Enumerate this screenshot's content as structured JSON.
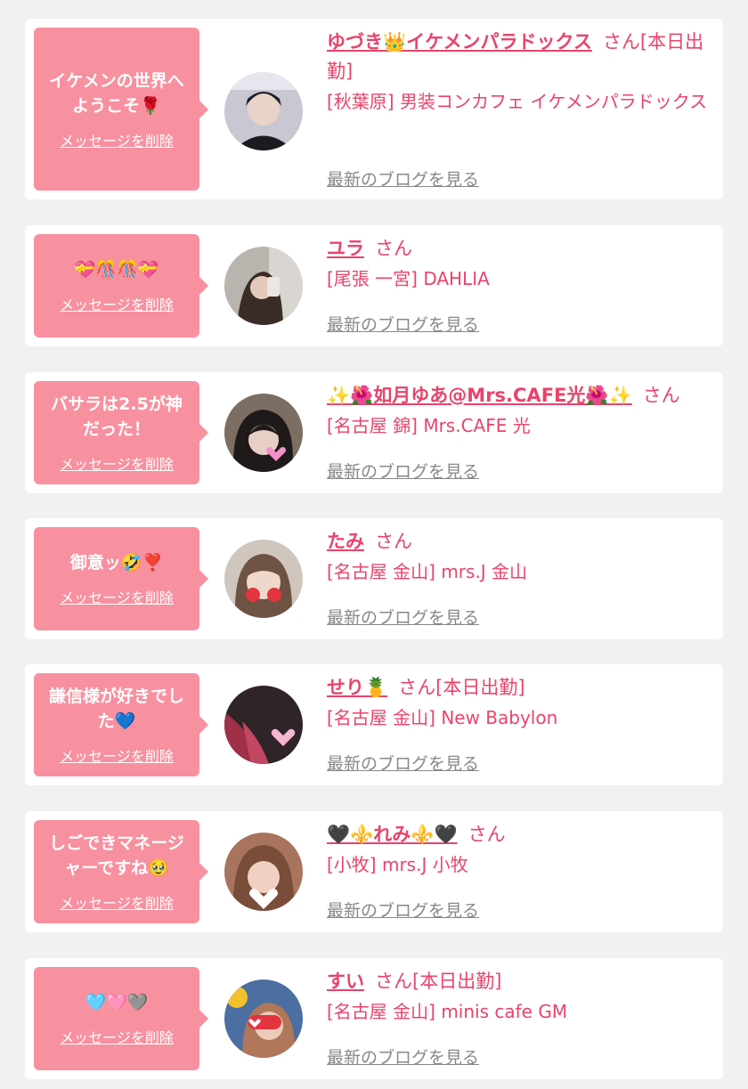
{
  "common": {
    "delete_label": "メッセージを削除",
    "blog_label": "最新のブログを見る"
  },
  "colors": {
    "background": "#f1f1f1",
    "bubble": "#f7909f",
    "accent": "#e8446a",
    "link_gray": "#888888"
  },
  "entries": [
    {
      "message": "イケメンの世界へようこそ🌹",
      "name": "ゆづき👑イケメンパラドックス",
      "honorific": "さん[本日出勤]",
      "shop": "[秋葉原] 男装コンカフェ イケメンパラドックス",
      "avatar_icon": "avatar-photo"
    },
    {
      "message": "💝🎊🎊💝",
      "name": "ユラ",
      "honorific": "さん",
      "shop": "[尾張 一宮] DAHLIA",
      "avatar_icon": "avatar-photo"
    },
    {
      "message": "バサラは2.5が神だった！",
      "name": "✨🌺如月ゆあ@Mrs.CAFE光🌺✨",
      "honorific": "さん",
      "shop": "[名古屋 錦] Mrs.CAFE 光",
      "avatar_icon": "avatar-photo"
    },
    {
      "message": "御意ッ🤣❣️",
      "name": "たみ",
      "honorific": "さん",
      "shop": "[名古屋 金山] mrs.J 金山",
      "avatar_icon": "avatar-photo"
    },
    {
      "message": "謙信様が好きでした💙",
      "name": "せり🍍",
      "honorific": "さん[本日出勤]",
      "shop": "[名古屋 金山] New Babylon",
      "avatar_icon": "avatar-photo"
    },
    {
      "message": "しごできマネージャーですね🥹",
      "name": "🖤⚜️れみ⚜️🖤",
      "honorific": "さん",
      "shop": "[小牧] mrs.J 小牧",
      "avatar_icon": "avatar-photo"
    },
    {
      "message": "🩵🩷🩶",
      "name": "すい",
      "honorific": "さん[本日出勤]",
      "shop": "[名古屋 金山] minis cafe GM",
      "avatar_icon": "avatar-photo"
    }
  ]
}
